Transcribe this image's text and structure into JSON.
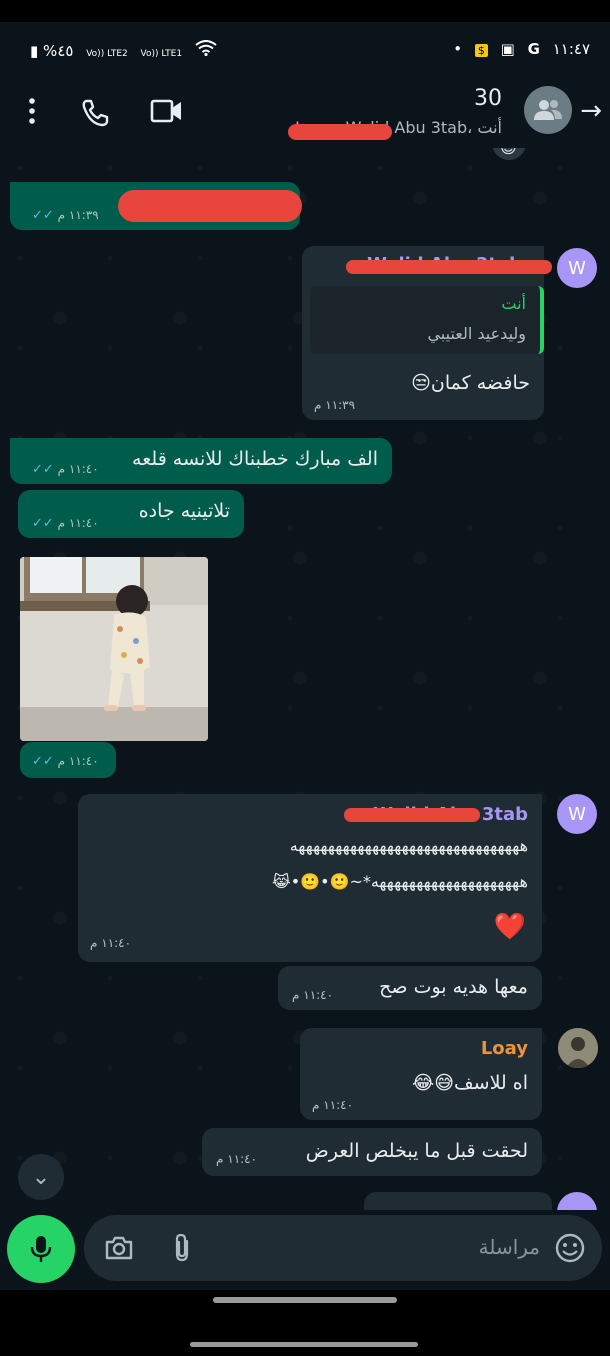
{
  "status_bar": {
    "battery": "%٤٥",
    "signal1": "Vo)) LTE2",
    "signal2": "Vo)) LTE1",
    "time": "١١:٤٧"
  },
  "header": {
    "title": "30",
    "subtitle": "Loay وWalid Abu 3tab، أنت"
  },
  "messages": [
    {
      "time": "١١:٣٩ م"
    },
    {
      "sender": "Walid Abu 3tab",
      "avatar": "W",
      "quote_author": "أنت",
      "quote_text": "وليدعيد العتيبي",
      "text": "حافضه كمان😒",
      "time": "١١:٣٩ م"
    },
    {
      "text": "الف مبارك خطبناك للانسه قلعه",
      "time": "١١:٤٠ م"
    },
    {
      "text": "تلاتينيه جاده",
      "time": "١١:٤٠ م"
    },
    {
      "time": "١١:٤٠ م"
    },
    {
      "sender": "Walid Abu 3tab",
      "avatar": "W",
      "line1": "هههههههههههههههههههههههههههههههه",
      "line2": "ههههههههههههههههههههه*~🙂•🙂•😹",
      "time": "١١:٤٠ م",
      "emoji": "❤️"
    },
    {
      "text": "معها هديه بوت صح",
      "time": "١١:٤٠ م"
    },
    {
      "sender": "Loay",
      "text": "اه للاسف😅😂",
      "time": "١١:٤٠ م"
    },
    {
      "text": "لحقت قبل ما يبخلص العرض",
      "time": "١١:٤٠ م"
    }
  ],
  "input": {
    "placeholder": "مراسلة"
  },
  "colors": {
    "background": "#0b141a",
    "outgoing_bubble": "#005c4b",
    "incoming_bubble": "#202c33",
    "accent_green": "#25d366",
    "sender_walid": "#a796f5",
    "sender_loay": "#f0923a"
  }
}
